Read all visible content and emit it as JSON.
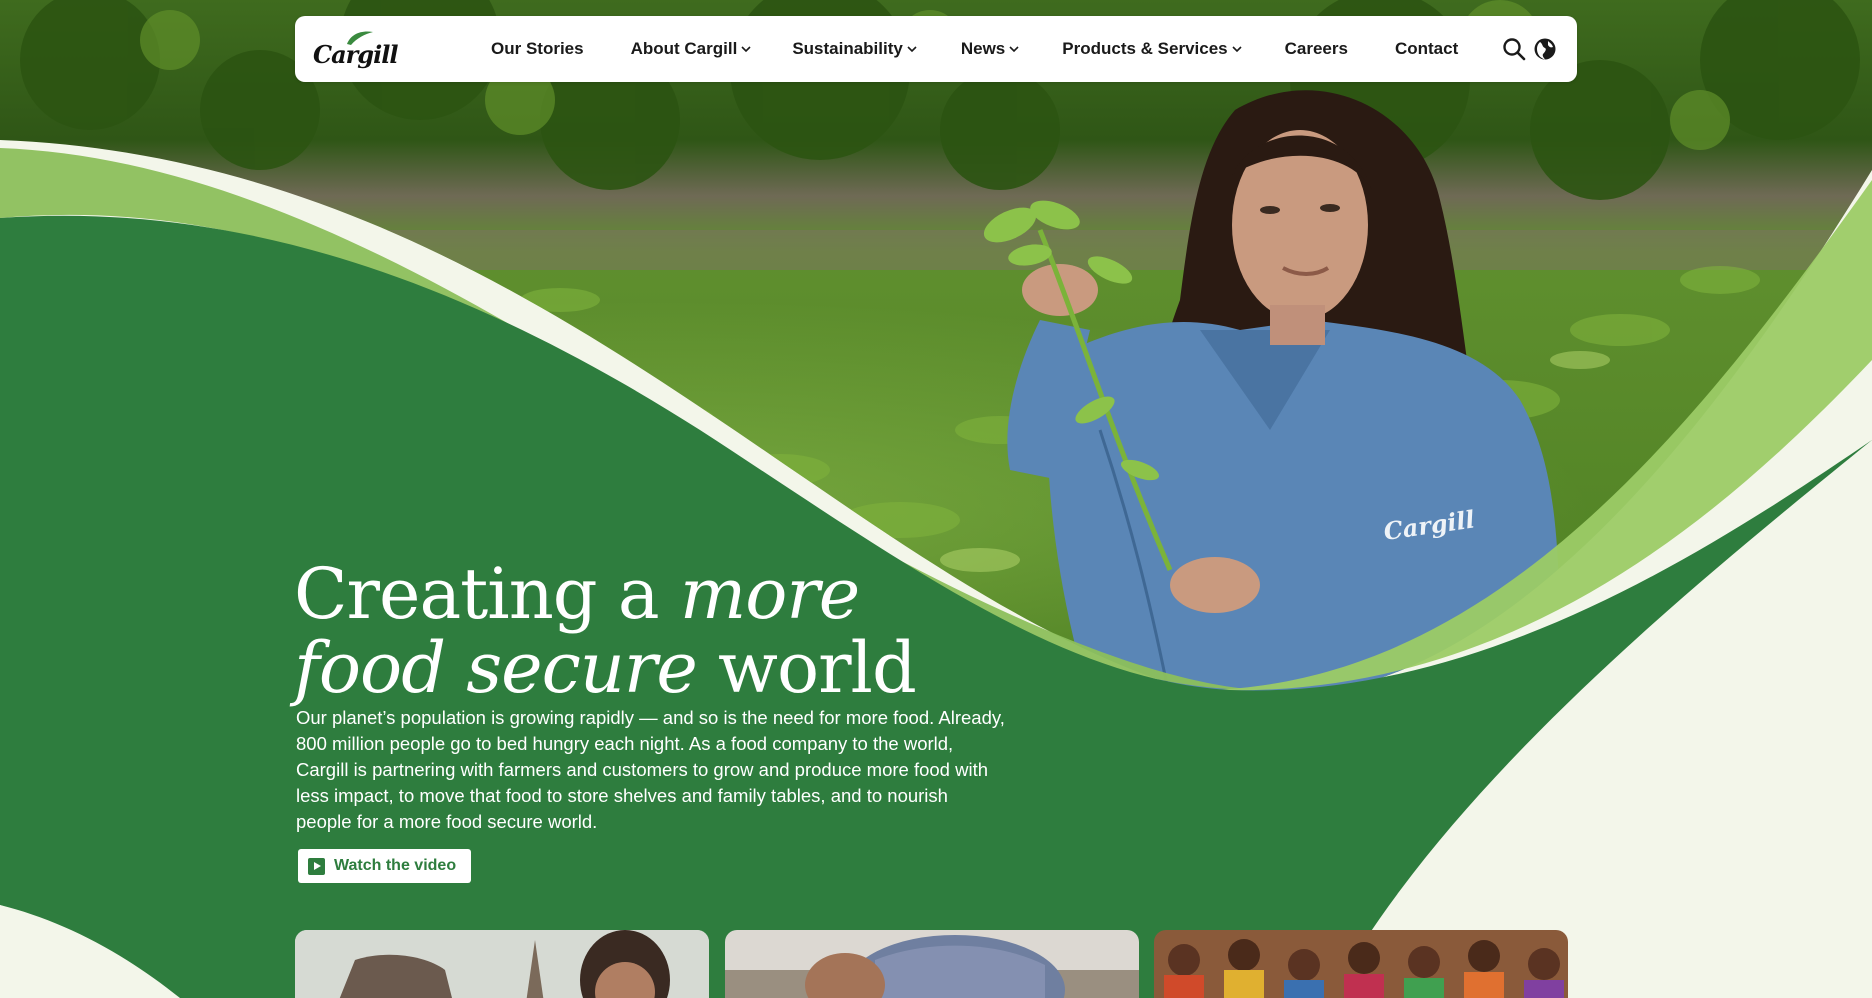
{
  "brand": {
    "logo_text": "Cargill",
    "primary_green": "#2e7d3e",
    "light_green": "#8bbf5a",
    "cream": "#f3f6ea"
  },
  "nav": {
    "items": [
      {
        "label": "Our Stories",
        "has_dropdown": false
      },
      {
        "label": "About Cargill",
        "has_dropdown": true
      },
      {
        "label": "Sustainability",
        "has_dropdown": true
      },
      {
        "label": "News",
        "has_dropdown": true
      },
      {
        "label": "Products & Services",
        "has_dropdown": true
      },
      {
        "label": "Careers",
        "has_dropdown": false
      },
      {
        "label": "Contact",
        "has_dropdown": false
      }
    ],
    "icons": [
      "search-icon",
      "globe-icon"
    ]
  },
  "hero": {
    "title_line1_regular": "Creating a ",
    "title_line1_italic": "more",
    "title_line2_italic": "food secure",
    "title_line2_regular": " world",
    "description": "Our planet’s population is growing rapidly — and so is the need for more food. Already, 800 million people go to bed hungry each night. As a food company to the world, Cargill is partnering with farmers and customers to grow and produce more food with less impact, to move that food to store shelves and family tables, and to nourish people for a more food secure world.",
    "cta_label": "Watch the video",
    "image_subject": "woman in denim shirt holding soybean plant in field",
    "shirt_logo_text": "Cargill"
  },
  "cards": [
    {
      "image_subject": "woman with livestock"
    },
    {
      "image_subject": "man in plaid shirt"
    },
    {
      "image_subject": "group of people in colorful clothing"
    }
  ]
}
